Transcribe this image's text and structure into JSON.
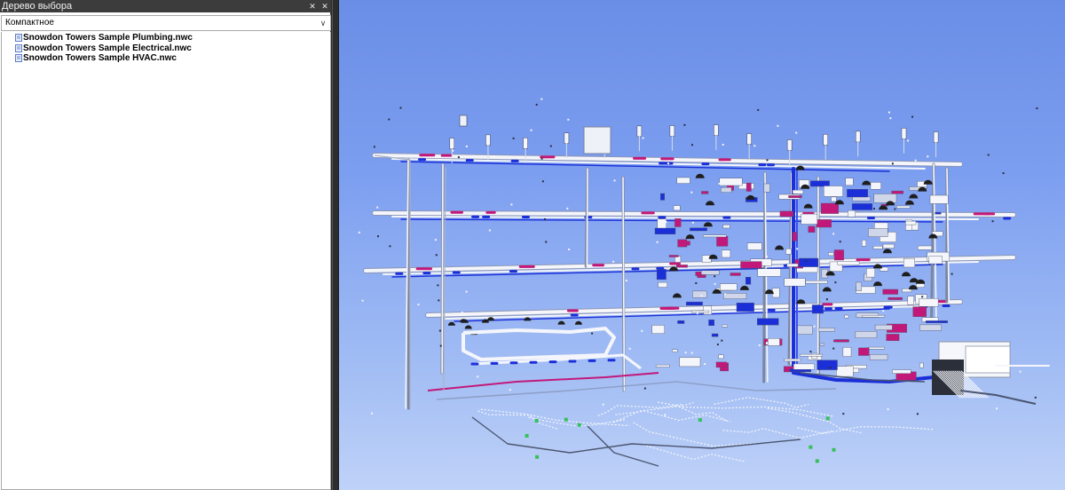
{
  "panel": {
    "title": "Дерево выбора",
    "dropdown_value": "Компактное",
    "tree_items": [
      {
        "label": "Snowdon Towers Sample Plumbing.nwc"
      },
      {
        "label": "Snowdon Towers Sample Electrical.nwc"
      },
      {
        "label": "Snowdon Towers Sample HVAC.nwc"
      }
    ]
  },
  "colors": {
    "pipe_white": "#f4f6fb",
    "pipe_blue": "#1b2fd8",
    "pipe_magenta": "#c2187a",
    "fixture_dark": "#1e1e1e",
    "marker_green": "#36c05a"
  }
}
